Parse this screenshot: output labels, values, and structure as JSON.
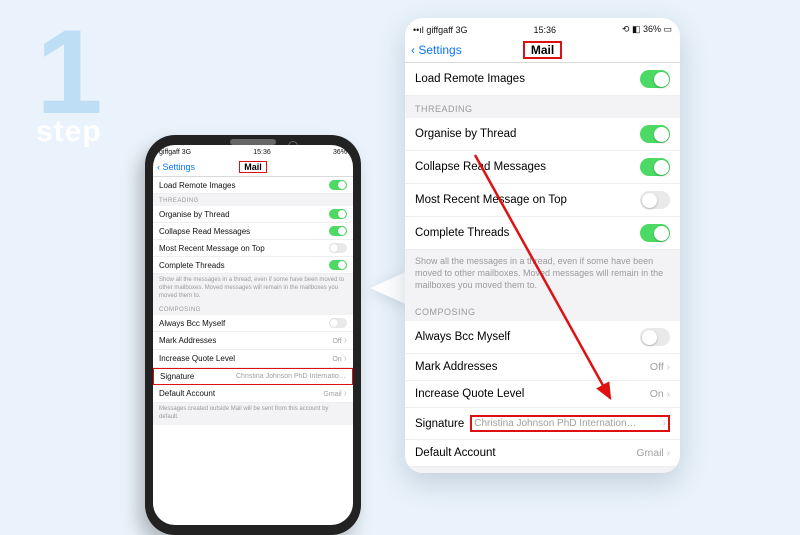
{
  "step": {
    "number": "1",
    "label": "step"
  },
  "statusbar": {
    "carrier": "giffgaff  3G",
    "time": "15:36",
    "battery": "36%"
  },
  "nav": {
    "back": "Settings",
    "title": "Mail"
  },
  "rows": {
    "load_remote": "Load Remote Images",
    "organise": "Organise by Thread",
    "collapse": "Collapse Read Messages",
    "most_recent": "Most Recent Message on Top",
    "complete": "Complete Threads",
    "always_bcc": "Always Bcc Myself",
    "mark_addr": "Mark Addresses",
    "mark_addr_val": "Off",
    "increase_quote": "Increase Quote Level",
    "increase_quote_val": "On",
    "signature": "Signature",
    "signature_val": "Christina Johnson PhD Internation…",
    "default_account": "Default Account",
    "default_account_val": "Gmail"
  },
  "sections": {
    "threading": "THREADING",
    "composing": "COMPOSING"
  },
  "footers": {
    "threads": "Show all the messages in a thread, even if some have been moved to other mailboxes. Moved messages will remain in the mailboxes you moved them to.",
    "default": "Messages created outside Mail will be sent from this account by default."
  },
  "chevron": "›",
  "backchev": "‹"
}
